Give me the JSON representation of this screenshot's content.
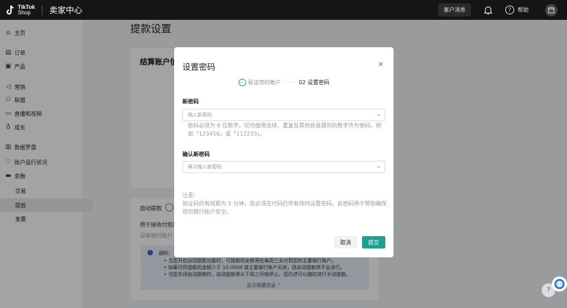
{
  "topbar": {
    "logo_line1": "TikTok",
    "logo_line2": "Shop",
    "title": "卖家中心",
    "message_label": "客户消息",
    "help_label": "帮助"
  },
  "sidebar": {
    "items": [
      {
        "label": "主页",
        "icon": "home-icon"
      },
      {
        "label": "订单",
        "icon": "order-icon"
      },
      {
        "label": "产品",
        "icon": "product-icon"
      },
      {
        "label": "营销",
        "icon": "megaphone-icon"
      },
      {
        "label": "联盟",
        "icon": "people-icon"
      },
      {
        "label": "直播和视频",
        "icon": "video-icon"
      },
      {
        "label": "成长",
        "icon": "growth-icon"
      },
      {
        "label": "数据罗盘",
        "icon": "chart-icon"
      },
      {
        "label": "账户运行状况",
        "icon": "heart-icon"
      },
      {
        "label": "金融",
        "icon": "wallet-icon"
      },
      {
        "label": "交易",
        "icon": ""
      },
      {
        "label": "提款",
        "icon": ""
      },
      {
        "label": "发票",
        "icon": ""
      }
    ]
  },
  "page": {
    "title": "提款设置",
    "settlement_title": "结算账户信",
    "auto_withdraw_label": "自动提款",
    "desc": "用于接收付款的",
    "no_account": "没有银行账户",
    "notice": {
      "title": "通知：",
      "lines": [
        "• 当您开启自动提款功能时，可提款的全额将在每周三支付到您的主要银行账户。",
        "• 如果可供提款的金额少于 10,000đ 或主要银行账户无效，则自动提款将不会进行。",
        "• 当您关闭自动提款时，自动提款将从下周三开始停止。您仍然可以随时进行手动提款。"
      ],
      "show_less": "显示简要信息 ⌃"
    }
  },
  "modal": {
    "title": "设置密码",
    "step1": "验证您的帐户",
    "step_dots": "····",
    "step2": "02 设置密码",
    "new_pw_label": "新密码",
    "new_pw_placeholder": "输入新密码",
    "hint": "密码必须为 6 位数字。切勿使用连续、重复及其他容易猜到的数字作为密码，例如「123456」或「112233」。",
    "confirm_label": "确认新密码",
    "confirm_placeholder": "再次输入新密码",
    "note_title": "注意:",
    "note_body": "验证码的有效期为 5 分钟。您必须在代码仍然有效时设置密码。此密码用于帮助确保您的银行账户安全。",
    "cancel": "取消",
    "submit": "提交"
  },
  "colors": {
    "accent": "#1f9f8f",
    "topbar": "#151517"
  }
}
